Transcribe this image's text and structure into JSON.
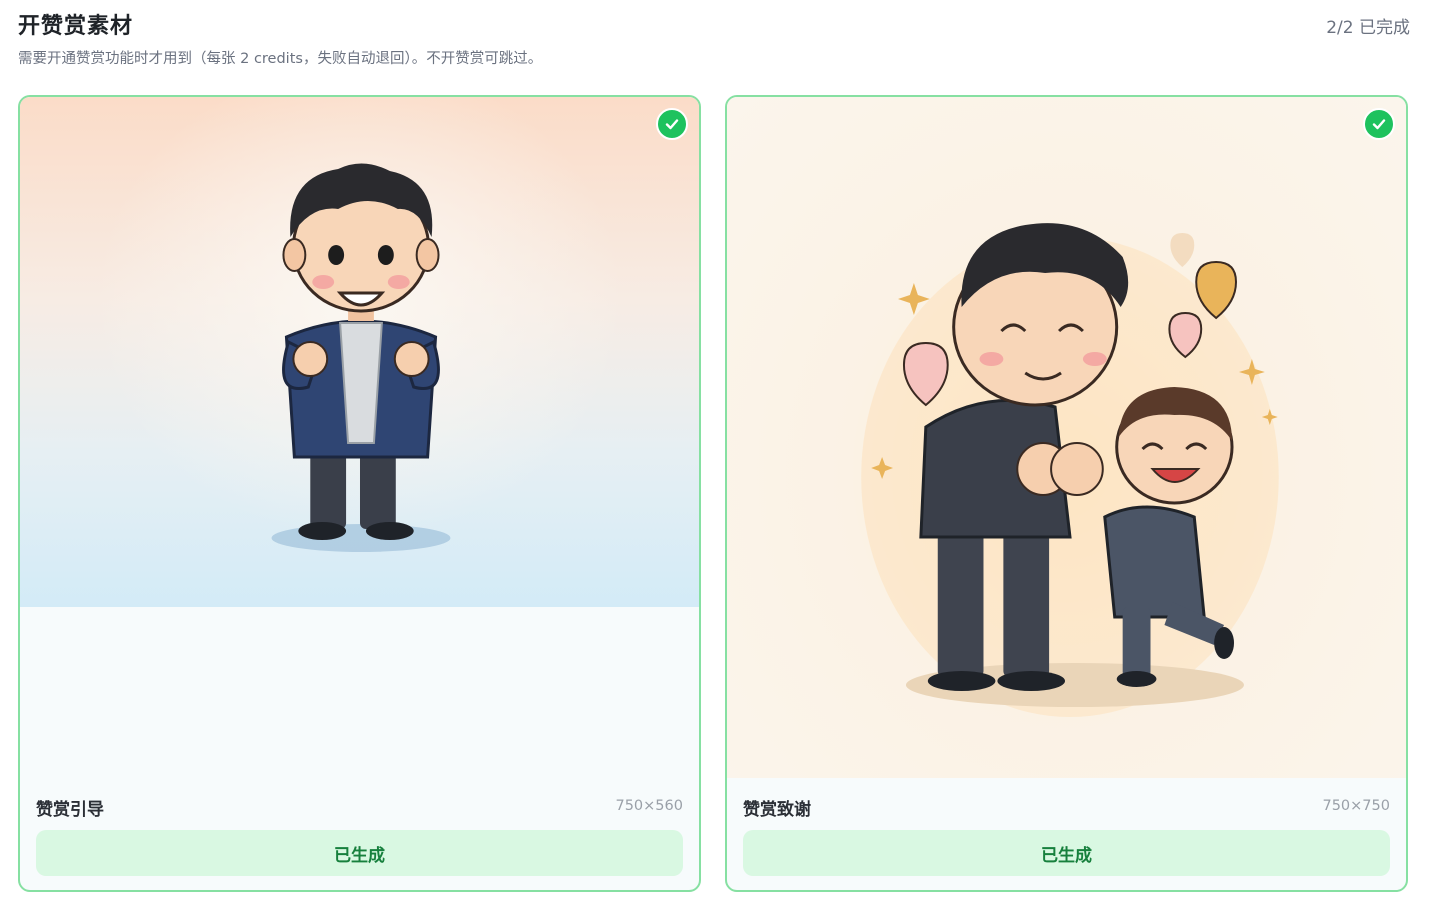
{
  "header": {
    "title": "开赞赏素材",
    "progress": "2/2 已完成",
    "subtitle": "需要开通赞赏功能时才用到（每张 2 credits，失败自动退回）。不开赞赏可跳过。"
  },
  "cards": [
    {
      "name": "赞赏引导",
      "dimensions": "750×560",
      "status_label": "已生成",
      "checked": true,
      "image": "cartoon-man-finger-heart"
    },
    {
      "name": "赞赏致谢",
      "dimensions": "750×750",
      "status_label": "已生成",
      "checked": true,
      "image": "cartoon-man-and-boy-heart-hands"
    }
  ],
  "colors": {
    "accent_green": "#1ec25e",
    "card_border": "#86e0a2",
    "button_bg": "#d9f8e2",
    "button_text": "#17803d"
  }
}
